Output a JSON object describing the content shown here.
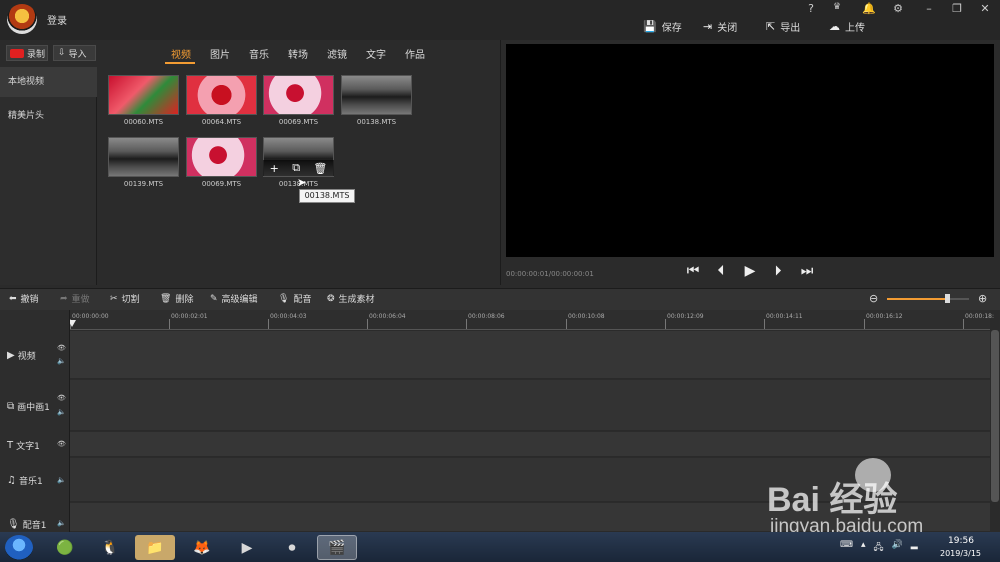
{
  "window": {
    "login_label": "登录",
    "title_icons": [
      "?",
      "VIP",
      "bell",
      "gear",
      "minimize",
      "restore",
      "close"
    ],
    "actions": [
      {
        "icon": "save-icon",
        "label": "保存"
      },
      {
        "icon": "exit-icon",
        "label": "关闭"
      },
      {
        "icon": "export-icon",
        "label": "导出"
      },
      {
        "icon": "upload-icon",
        "label": "上传"
      }
    ]
  },
  "media_panel": {
    "record_label": "录制",
    "import_label": "导入",
    "tabs": [
      "视频",
      "图片",
      "音乐",
      "转场",
      "滤镜",
      "文字",
      "作品"
    ],
    "active_tab": "视频",
    "sidebar": [
      "本地视频",
      "精美片头"
    ],
    "thumbnails": [
      {
        "name": "00060.MTS",
        "style": "tv1"
      },
      {
        "name": "00064.MTS",
        "style": "tv2"
      },
      {
        "name": "00069.MTS",
        "style": "tv3"
      },
      {
        "name": "00138.MTS",
        "style": "tv4"
      },
      {
        "name": "00139.MTS",
        "style": "tv4"
      },
      {
        "name": "00069.MTS",
        "style": "tv3"
      },
      {
        "name": "00138.MTS",
        "style": "tv4"
      }
    ],
    "hover_actions": [
      "+",
      "⧉",
      "🗑"
    ],
    "tooltip": "00138.MTS"
  },
  "preview": {
    "timecode": "00:00:00:01/00:00:00:01",
    "controls": [
      "first-frame",
      "previous-frame",
      "play",
      "next-frame",
      "last-frame"
    ]
  },
  "edit_toolbar": [
    {
      "icon": "undo-icon",
      "label": "撤销",
      "enabled": true
    },
    {
      "icon": "redo-icon",
      "label": "重做",
      "enabled": false
    },
    {
      "icon": "cut-icon",
      "label": "切割",
      "enabled": true
    },
    {
      "icon": "delete-icon",
      "label": "删除",
      "enabled": true
    },
    {
      "icon": "advanced-edit-icon",
      "label": "高级编辑",
      "enabled": true
    },
    {
      "icon": "mic-icon",
      "label": "配音",
      "enabled": true
    },
    {
      "icon": "generate-icon",
      "label": "生成素材",
      "enabled": true
    }
  ],
  "zoom": {
    "level": 0.73
  },
  "ruler": [
    "00:00:00:00",
    "00:00:02:01",
    "00:00:04:03",
    "00:00:06:04",
    "00:00:08:06",
    "00:00:10:08",
    "00:00:12:09",
    "00:00:14:11",
    "00:00:16:12",
    "00:00:18:"
  ],
  "tracks": [
    {
      "icon": "video-icon",
      "label": "视频"
    },
    {
      "icon": "pip-icon",
      "label": "画中画1"
    },
    {
      "icon": "text-icon",
      "label": "文字1"
    },
    {
      "icon": "music-icon",
      "label": "音乐1"
    },
    {
      "icon": "mic-icon",
      "label": "配音1"
    }
  ],
  "taskbar": {
    "time": "19:56",
    "date": "2019/3/15"
  },
  "watermark": {
    "brand": "Bai  经验",
    "url": "jingyan.baidu.com"
  }
}
